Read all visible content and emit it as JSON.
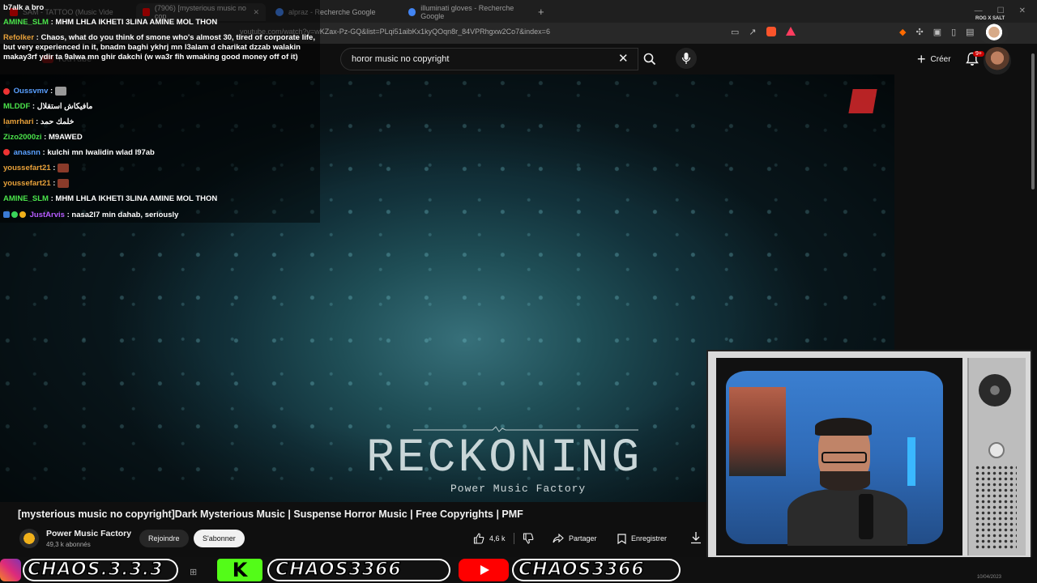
{
  "tabs": [
    {
      "label": "SAM - TATTOO (Music Vide"
    },
    {
      "label": "(7906) [mysterious music no cop"
    },
    {
      "label": "alpraz - Recherche Google"
    },
    {
      "label": "illuminati gloves - Recherche Google"
    }
  ],
  "url": "youtube.com/watch?v=wKZax-Pz-GQ&list=PLqi51aibKx1kyQOqn8r_84VPRhgxw2Co7&index=6",
  "youtube": {
    "logo_text": "YouTube",
    "search_value": "horor music no copyright",
    "create_label": "Créer",
    "notif_badge": "9+"
  },
  "streamer_badge": "ROG X SALT",
  "chat": {
    "header": "b7alk a bro",
    "messages": [
      {
        "user": "AMINE_SLM",
        "text": "MHM LHLA IKHETI 3LINA AMINE MOL THON",
        "color": "#4be34b"
      },
      {
        "user": "Refolker",
        "text": "Chaos, what do you think of smone who's almost 30, tired of corporate life, but very experienced in it, bnadm baghi ykhrj mn l3alam d charikat dzzab walakin makay3rf ydir ta 9alwa mn ghir dakchi (w wa3r fih wmaking good money off of it)",
        "color": "#e8a13a"
      },
      {
        "user": "Oussvmv",
        "text": "",
        "color": "#5aa0ff"
      },
      {
        "user": "MLDDF",
        "text": "مافيكاش استقلال",
        "color": "#4be34b"
      },
      {
        "user": "lamrhari",
        "text": "خلمك حمد",
        "color": "#e8a13a"
      },
      {
        "user": "Zizo2000zi",
        "text": "M9AWED",
        "color": "#4be34b"
      },
      {
        "user": "anasnn",
        "text": "kulchi mn lwalidin wlad l97ab",
        "color": "#5aa0ff"
      },
      {
        "user": "youssefart21",
        "text": "",
        "color": "#e8a13a"
      },
      {
        "user": "youssefart21",
        "text": "",
        "color": "#e8a13a"
      },
      {
        "user": "AMINE_SLM",
        "text": "MHM LHLA IKHETI 3LINA AMINE MOL THON",
        "color": "#4be34b"
      },
      {
        "user": "JustArvis",
        "text": "nasa2l7 min dahab, seriously",
        "color": "#b65cff"
      }
    ]
  },
  "video": {
    "overlay_title": "RECKONING",
    "overlay_subtitle": "Power Music Factory",
    "title": "[mysterious music no copyright]Dark Mysterious Music | Suspense Horror Music | Free Copyrights | PMF"
  },
  "channel": {
    "name": "Power Music Factory",
    "subscribers": "49,3 k abonnés",
    "join_label": "Rejoindre",
    "subscribe_label": "S'abonner"
  },
  "actions": {
    "likes": "4,6 k",
    "share_label": "Partager",
    "save_label": "Enregistrer"
  },
  "banner": {
    "items": [
      "CHAOS.3.3.3",
      "CHAOS3366",
      "CHAOS3366"
    ]
  },
  "clock": "10/04/2023",
  "colors": {
    "youtube_red": "#ff0000",
    "kick_green": "#53fc18",
    "subscribe_bg": "#f1f1f1"
  }
}
